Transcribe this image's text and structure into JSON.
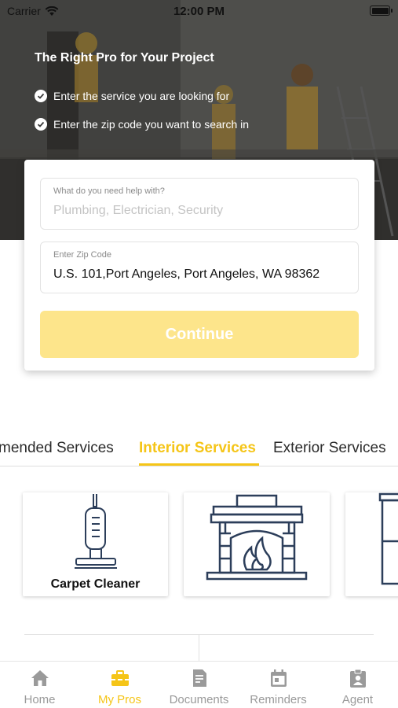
{
  "status_bar": {
    "carrier": "Carrier",
    "time": "12:00 PM"
  },
  "hero": {
    "title": "The Right Pro for Your Project",
    "steps": [
      "Enter the service you are looking for",
      "Enter the zip code you want to search in"
    ]
  },
  "search_card": {
    "service_field": {
      "label": "What do you need help with?",
      "placeholder": "Plumbing, Electrician, Security",
      "value": ""
    },
    "zip_field": {
      "label": "Enter Zip Code",
      "value": "U.S. 101,Port Angeles, Port Angeles, WA 98362"
    },
    "continue_label": "Continue"
  },
  "tabs": [
    {
      "label": "mended Services",
      "active": false
    },
    {
      "label": "Interior Services",
      "active": true
    },
    {
      "label": "Exterior Services",
      "active": false
    }
  ],
  "services": [
    {
      "label": "Carpet Cleaner",
      "icon": "vacuum-icon"
    },
    {
      "label": "",
      "icon": "fireplace-icon"
    },
    {
      "label": "",
      "icon": "window-icon"
    }
  ],
  "bottom_nav": [
    {
      "label": "Home",
      "icon": "home-icon",
      "active": false
    },
    {
      "label": "My Pros",
      "icon": "toolbox-icon",
      "active": true
    },
    {
      "label": "Documents",
      "icon": "document-icon",
      "active": false
    },
    {
      "label": "Reminders",
      "icon": "calendar-icon",
      "active": false
    },
    {
      "label": "Agent",
      "icon": "agent-badge-icon",
      "active": false
    }
  ],
  "colors": {
    "accent": "#f5c518",
    "button_disabled": "#fde58b",
    "icon_stroke": "#2c3e5a",
    "nav_inactive": "#9a9a9a"
  }
}
